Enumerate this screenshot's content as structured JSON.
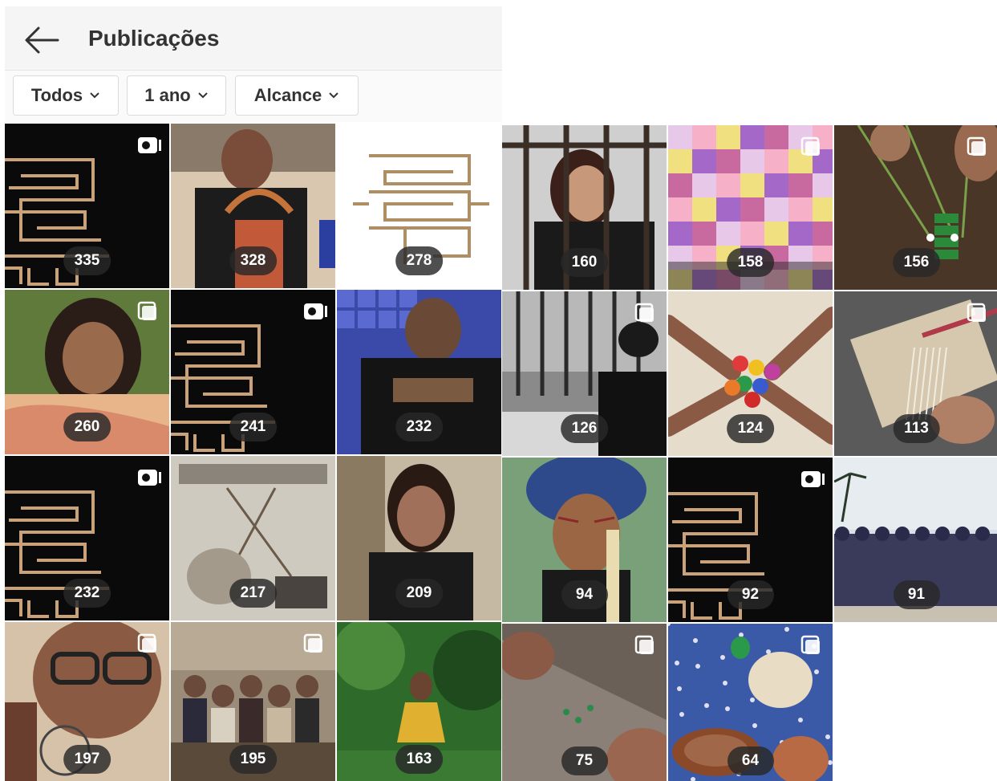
{
  "header": {
    "title": "Publicações"
  },
  "filters": [
    {
      "label": "Todos"
    },
    {
      "label": "1 ano"
    },
    {
      "label": "Alcance"
    }
  ],
  "left_grid": {
    "posts": [
      {
        "count": "335",
        "type": "video-logo",
        "badge": "video-icon"
      },
      {
        "count": "328",
        "type": "photo-weaving",
        "badge": ""
      },
      {
        "count": "278",
        "type": "logo-white",
        "badge": ""
      },
      {
        "count": "260",
        "type": "photo-portrait",
        "badge": "multi-icon"
      },
      {
        "count": "241",
        "type": "video-logo",
        "badge": "video-icon"
      },
      {
        "count": "232",
        "type": "photo-tiles",
        "badge": ""
      },
      {
        "count": "232",
        "type": "video-logo",
        "badge": "video-icon"
      },
      {
        "count": "217",
        "type": "photo-poster",
        "badge": ""
      },
      {
        "count": "209",
        "type": "photo-tree",
        "badge": ""
      },
      {
        "count": "197",
        "type": "photo-glasses",
        "badge": "multi-icon"
      },
      {
        "count": "195",
        "type": "photo-group",
        "badge": "multi-icon"
      },
      {
        "count": "163",
        "type": "photo-forest",
        "badge": ""
      }
    ]
  },
  "right_grid": {
    "posts": [
      {
        "count": "160",
        "type": "photo-bars",
        "badge": ""
      },
      {
        "count": "158",
        "type": "photo-quilt",
        "badge": "multi-icon"
      },
      {
        "count": "156",
        "type": "photo-beads",
        "badge": "multi-icon"
      },
      {
        "count": "126",
        "type": "photo-bars2",
        "badge": "multi-icon"
      },
      {
        "count": "124",
        "type": "photo-hands",
        "badge": ""
      },
      {
        "count": "113",
        "type": "photo-loom",
        "badge": "multi-icon"
      },
      {
        "count": "94",
        "type": "photo-headdress",
        "badge": ""
      },
      {
        "count": "92",
        "type": "video-logo",
        "badge": "video-icon"
      },
      {
        "count": "91",
        "type": "photo-beach",
        "badge": ""
      },
      {
        "count": "75",
        "type": "photo-table",
        "badge": "multi-icon"
      },
      {
        "count": "64",
        "type": "photo-pottery",
        "badge": "multi-icon"
      }
    ]
  }
}
